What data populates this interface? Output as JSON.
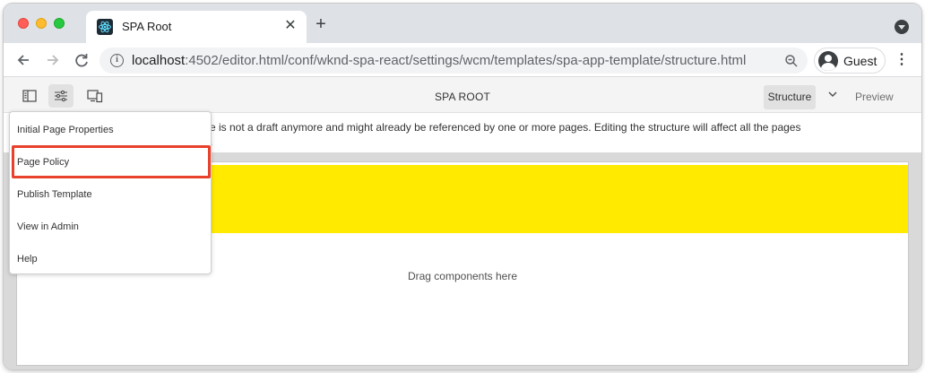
{
  "browser": {
    "tab_title": "SPA Root",
    "tab_close": "✕",
    "new_tab": "+",
    "url_host": "localhost",
    "url_rest": ":4502/editor.html/conf/wknd-spa-react/settings/wcm/templates/spa-app-template/structure.html",
    "profile_label": "Guest",
    "info_glyph": "i"
  },
  "editor": {
    "title": "SPA ROOT",
    "mode_label": "Structure",
    "preview_label": "Preview"
  },
  "notice": {
    "text": "e is not a draft anymore and might already be referenced by one or more pages. Editing the structure will affect all the pages",
    "text_line2": "."
  },
  "menu": {
    "items": [
      {
        "label": "Initial Page Properties"
      },
      {
        "label": "Page Policy"
      },
      {
        "label": "Publish Template"
      },
      {
        "label": "View in Admin"
      },
      {
        "label": "Help"
      }
    ],
    "highlighted_index": 1
  },
  "canvas": {
    "dropzone_text": "Drag components here",
    "header_color": "#ffea00"
  },
  "colors": {
    "highlight": "#e8412c",
    "tabstrip": "#dee1e6"
  }
}
